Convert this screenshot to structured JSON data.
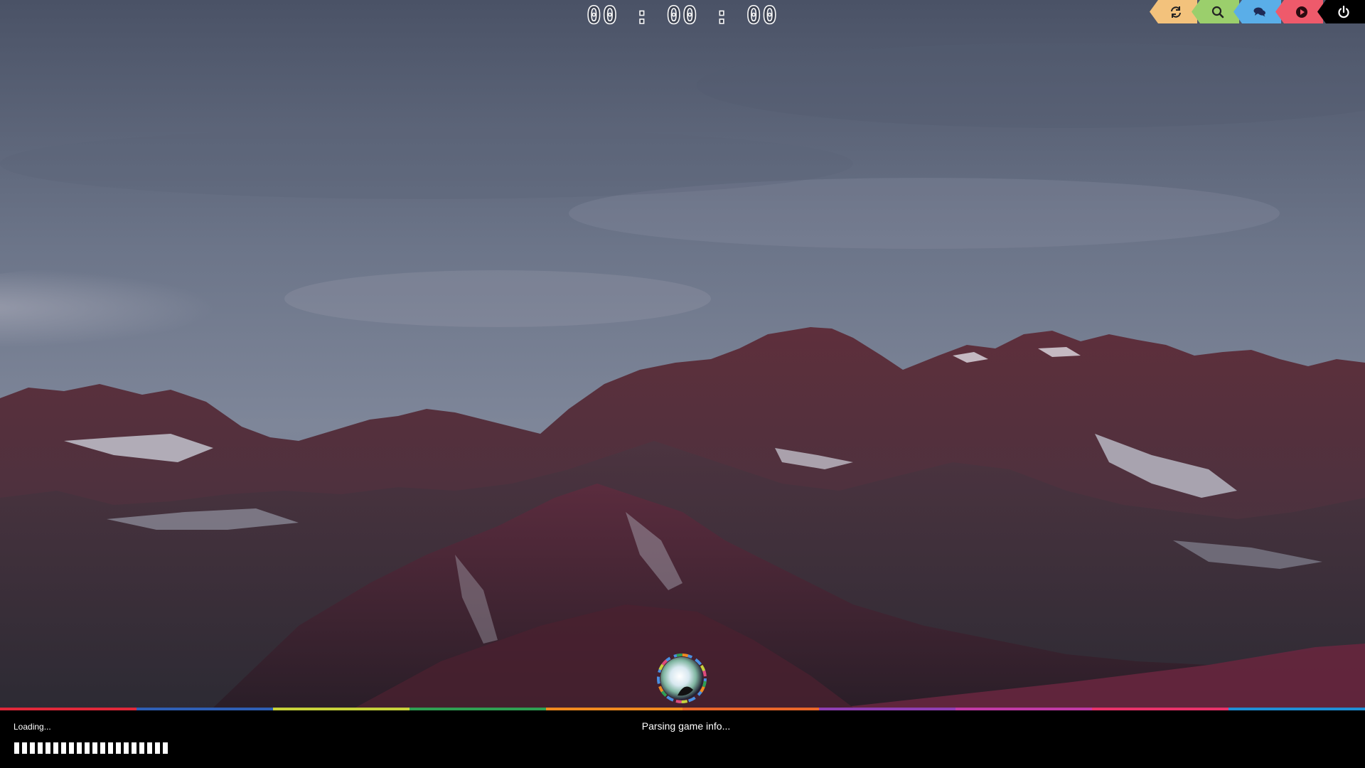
{
  "timer": {
    "text": "00:00:00"
  },
  "toolbar": {
    "buttons": [
      {
        "icon": "refresh-icon",
        "color": "#f3c27c"
      },
      {
        "icon": "search-icon",
        "color": "#9bcf6c"
      },
      {
        "icon": "chat-icon",
        "color": "#5aaee8"
      },
      {
        "icon": "play-icon",
        "color": "#ee5a6b"
      },
      {
        "icon": "power-icon",
        "color": "#000000"
      }
    ]
  },
  "status": {
    "loading_label": "Loading...",
    "message": "Parsing game info...",
    "progress_blocks": 20
  },
  "color_strip": [
    "#e0283a",
    "#2f5fb5",
    "#c7d23b",
    "#2f9f53",
    "#f08a1f",
    "#e8672a",
    "#8f3fb3",
    "#c03aa6",
    "#e8326a",
    "#1f8fd6"
  ]
}
